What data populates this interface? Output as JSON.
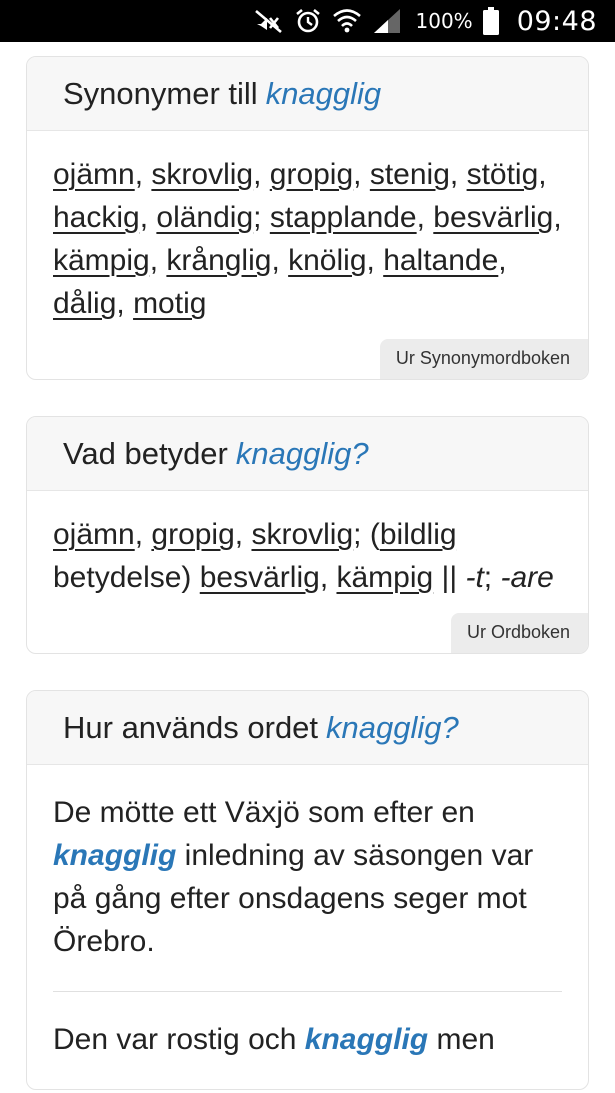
{
  "statusbar": {
    "battery_pct": "100%",
    "time": "09:48",
    "icons": [
      "mute-icon",
      "alarm-icon",
      "wifi-icon",
      "signal-icon",
      "battery-icon"
    ]
  },
  "colors": {
    "accent": "#2a77b7",
    "header_bg": "#f7f7f7",
    "tag_bg": "#ececec"
  },
  "keyword": "knagglig",
  "card1": {
    "title_prefix": "Synonymer till",
    "title_kw": "knagglig",
    "synonyms": [
      {
        "w": "ojämn",
        "sep": ", "
      },
      {
        "w": "skrovlig",
        "sep": ", "
      },
      {
        "w": "gropig",
        "sep": ", "
      },
      {
        "w": "stenig",
        "sep": ", "
      },
      {
        "w": "stötig",
        "sep": ", "
      },
      {
        "w": "hackig",
        "sep": ", "
      },
      {
        "w": "oländig",
        "sep": "; "
      },
      {
        "w": "stapplande",
        "sep": ", "
      },
      {
        "w": "besvärlig",
        "sep": ", "
      },
      {
        "w": "kämpig",
        "sep": ", "
      },
      {
        "w": "krånglig",
        "sep": ", "
      },
      {
        "w": "knölig",
        "sep": ", "
      },
      {
        "w": "haltande",
        "sep": ", "
      },
      {
        "w": "dålig",
        "sep": ", "
      },
      {
        "w": "motig",
        "sep": ""
      }
    ],
    "source": "Ur Synonymordboken"
  },
  "card2": {
    "title_prefix": "Vad betyder",
    "title_kw": "knagglig?",
    "w1": "ojämn",
    "s1": ", ",
    "w2": "gropig",
    "s2": ", ",
    "w3": "skrovlig",
    "s3": "; (",
    "w4": "bildlig",
    "s4": " betydelse) ",
    "w5": "besvärlig",
    "s5": ", ",
    "w6": "kämpig",
    "s6": " || ",
    "t_suffix": "-t",
    "s7": "; ",
    "are_suffix": "-are",
    "source": "Ur Ordboken"
  },
  "card3": {
    "title_prefix": "Hur används ordet",
    "title_kw": "knagglig?",
    "ex1_pre": "De mötte ett Växjö som efter en ",
    "ex1_kw": "knagglig",
    "ex1_post": " inledning av säsongen var på gång efter onsdagens seger mot Örebro.",
    "ex2_pre": "Den var rostig och ",
    "ex2_kw": "knagglig",
    "ex2_post": " men"
  }
}
